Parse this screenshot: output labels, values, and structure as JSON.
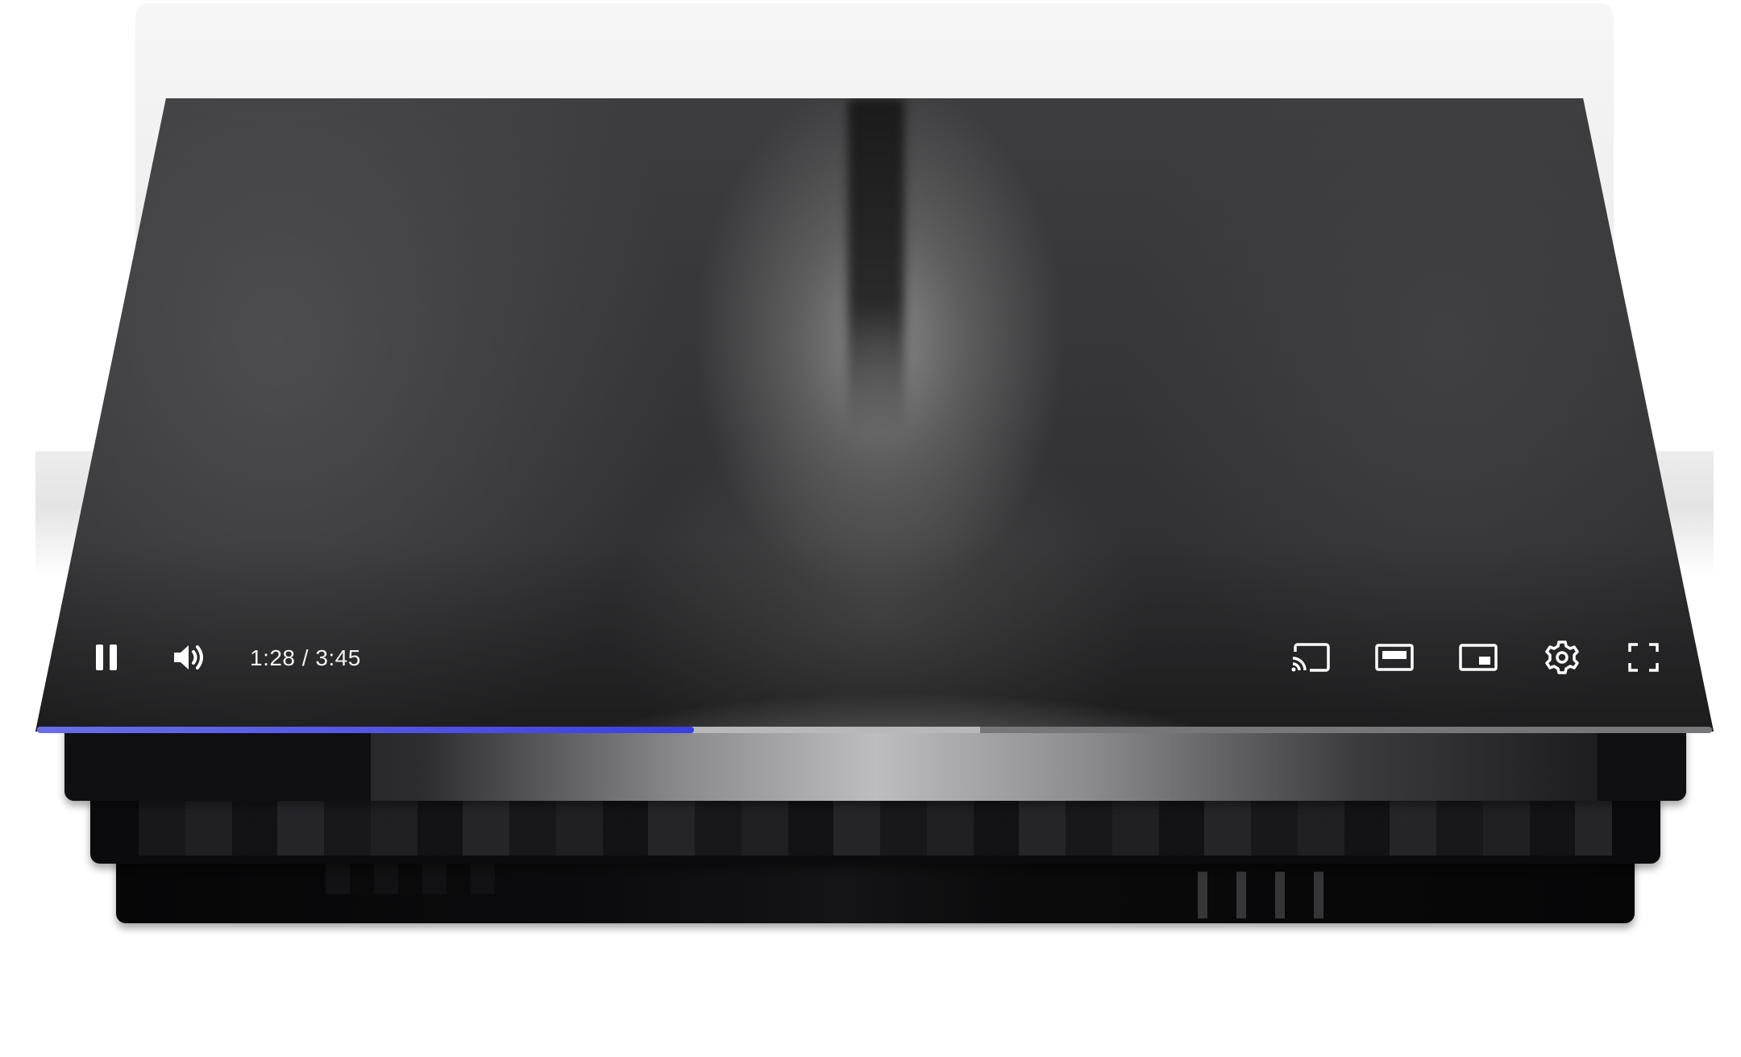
{
  "player": {
    "time_display": "1:28 / 3:45",
    "progress_played_fraction": 0.392,
    "progress_buffered_fraction": 0.563,
    "is_playing": true,
    "accent_color": "#3b3fe0"
  },
  "controls": {
    "left": [
      {
        "name": "pause-button",
        "icon": "pause-icon"
      },
      {
        "name": "volume-button",
        "icon": "volume-icon"
      }
    ],
    "right": [
      {
        "name": "cast-button",
        "icon": "cast-icon"
      },
      {
        "name": "theater-mode-button",
        "icon": "theater-icon"
      },
      {
        "name": "miniplayer-button",
        "icon": "miniplayer-icon"
      },
      {
        "name": "settings-button",
        "icon": "gear-icon"
      },
      {
        "name": "fullscreen-button",
        "icon": "fullscreen-icon"
      }
    ]
  }
}
